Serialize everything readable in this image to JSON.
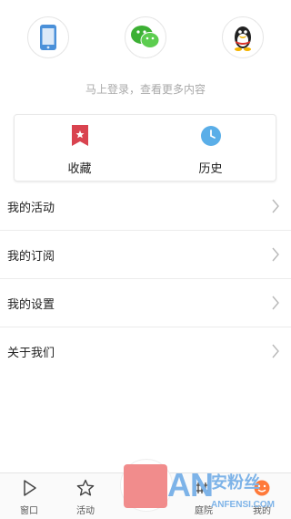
{
  "login": {
    "hint": "马上登录，查看更多内容",
    "methods": [
      {
        "icon": "phone-icon"
      },
      {
        "icon": "wechat-icon"
      },
      {
        "icon": "qq-icon"
      }
    ]
  },
  "quick_actions": [
    {
      "label": "收藏",
      "icon": "bookmark-icon",
      "color": "#d9434f"
    },
    {
      "label": "历史",
      "icon": "clock-icon",
      "color": "#5aaee8"
    }
  ],
  "menu": [
    {
      "label": "我的活动"
    },
    {
      "label": "我的订阅"
    },
    {
      "label": "我的设置"
    },
    {
      "label": "关于我们"
    }
  ],
  "tabbar": [
    {
      "label": "窗口",
      "icon": "play-icon"
    },
    {
      "label": "活动",
      "icon": "star-icon"
    },
    {
      "label": "庭院",
      "icon": "courtyard-icon"
    },
    {
      "label": "我的",
      "icon": "smile-icon"
    }
  ],
  "watermark": {
    "cn": "安粉丝",
    "en": "AN",
    "url": "ANFENSI.COM"
  }
}
